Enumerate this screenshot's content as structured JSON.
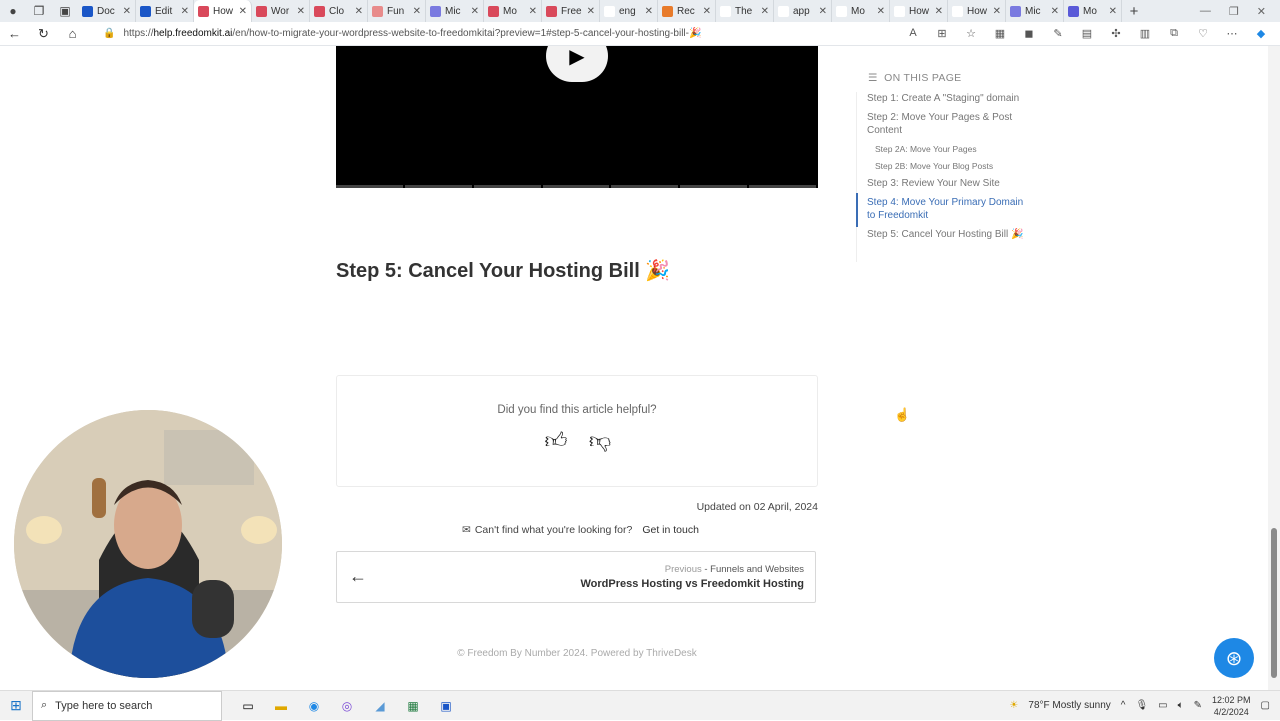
{
  "browser": {
    "tabs": [
      {
        "label": "Doc",
        "favicon_color": "#1a56c7",
        "active": false
      },
      {
        "label": "Edit",
        "favicon_color": "#1a56c7",
        "active": false
      },
      {
        "label": "How",
        "favicon_color": "#d9495b",
        "active": true
      },
      {
        "label": "Wor",
        "favicon_color": "#d9495b",
        "active": false
      },
      {
        "label": "Clo",
        "favicon_color": "#d9495b",
        "active": false
      },
      {
        "label": "Fun",
        "favicon_color": "#e88b8b",
        "active": false
      },
      {
        "label": "Mic",
        "favicon_color": "#7a7ae0",
        "active": false
      },
      {
        "label": "Mo",
        "favicon_color": "#d9495b",
        "active": false
      },
      {
        "label": "Free",
        "favicon_color": "#d9495b",
        "active": false
      },
      {
        "label": "eng",
        "favicon_color": "#ffffff",
        "active": false
      },
      {
        "label": "Rec",
        "favicon_color": "#e87b2b",
        "active": false
      },
      {
        "label": "The",
        "favicon_color": "#ffffff",
        "active": false
      },
      {
        "label": "app",
        "favicon_color": "#ffffff",
        "active": false
      },
      {
        "label": "Mo",
        "favicon_color": "#ffffff",
        "active": false
      },
      {
        "label": "How",
        "favicon_color": "#ffffff",
        "active": false
      },
      {
        "label": "How",
        "favicon_color": "#ffffff",
        "active": false
      },
      {
        "label": "Mic",
        "favicon_color": "#7a7ae0",
        "active": false
      },
      {
        "label": "Mo",
        "favicon_color": "#5a5ad8",
        "active": false
      }
    ],
    "url_prefix": "https://",
    "url_host": "help.freedomkit.ai",
    "url_path": "/en/how-to-migrate-your-wordpress-website-to-freedomkitai?preview=1#step-5-cancel-your-hosting-bill-🎉"
  },
  "article": {
    "step_heading": "Step 5: Cancel Your Hosting Bill 🎉",
    "feedback_question": "Did you find this article helpful?",
    "updated": "Updated on 02 April, 2024",
    "cant_find": "Can't find what you're looking for?",
    "get_in_touch": "Get in touch",
    "prev_label": "Previous",
    "prev_category": " - Funnels and Websites",
    "prev_title": "WordPress Hosting vs Freedomkit Hosting",
    "footer": "© Freedom By Number 2024. Powered by ThriveDesk"
  },
  "toc": {
    "heading": "ON THIS PAGE",
    "items": [
      {
        "label": "Step 1: Create A \"Staging\" domain",
        "level": 1,
        "active": false
      },
      {
        "label": "Step 2: Move Your Pages & Post Content",
        "level": 1,
        "active": false
      },
      {
        "label": "Step 2A: Move Your Pages",
        "level": 2,
        "active": false
      },
      {
        "label": "Step 2B: Move Your Blog Posts",
        "level": 2,
        "active": false
      },
      {
        "label": "Step 3: Review Your New Site",
        "level": 1,
        "active": false
      },
      {
        "label": "Step 4: Move Your Primary Domain to Freedomkit",
        "level": 1,
        "active": true
      },
      {
        "label": "Step 5: Cancel Your Hosting Bill 🎉",
        "level": 1,
        "active": false
      }
    ]
  },
  "taskbar": {
    "search_placeholder": "Type here to search",
    "weather": "78°F  Mostly sunny",
    "time": "12:02 PM",
    "date": "4/2/2024"
  },
  "colors": {
    "accent": "#3a6db5",
    "help_fab": "#1e88e5"
  }
}
